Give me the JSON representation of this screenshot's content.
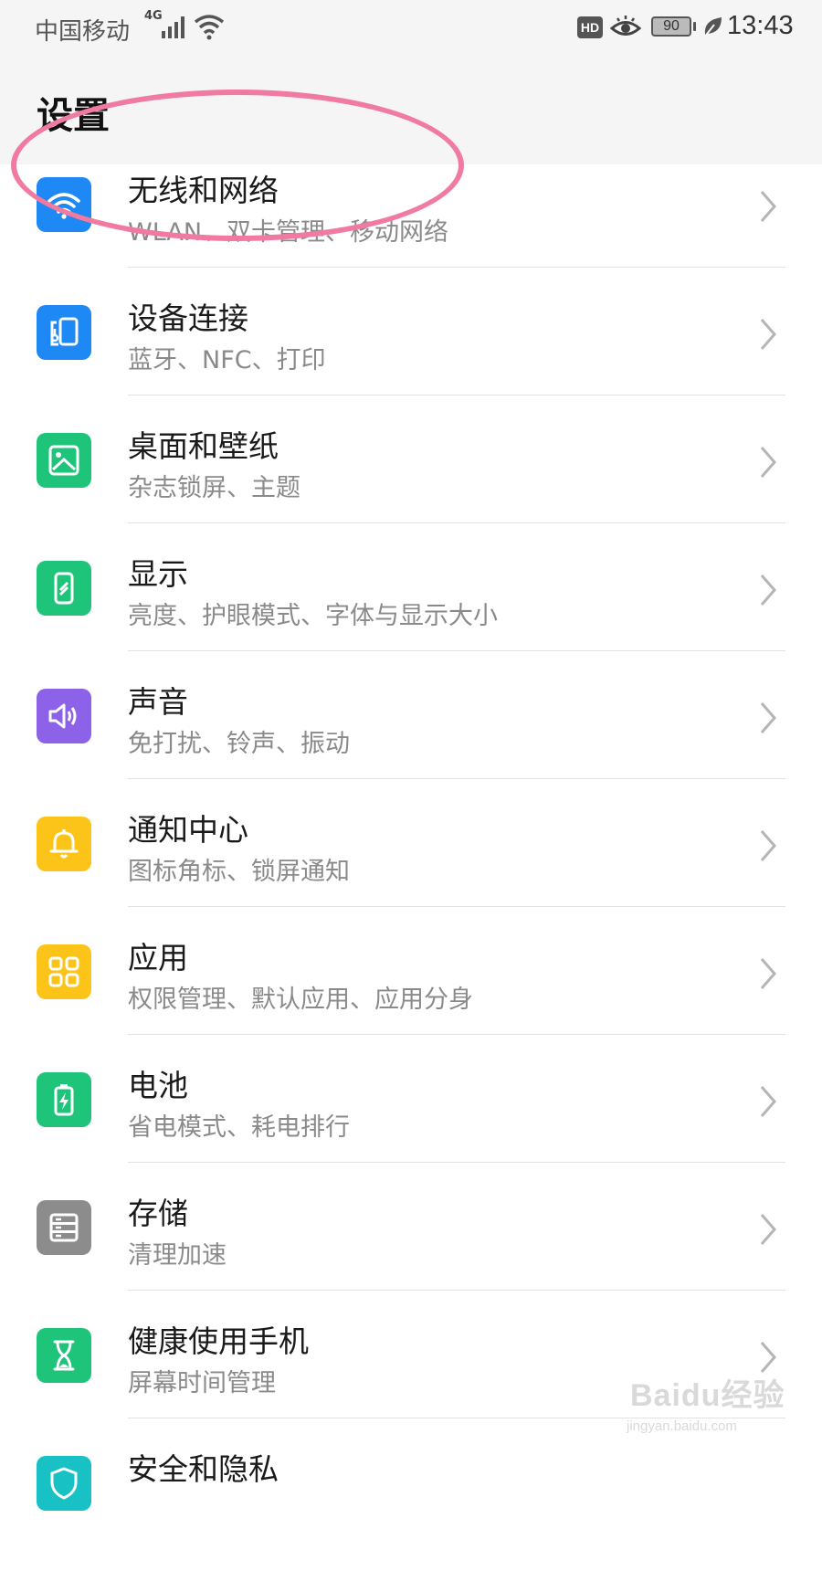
{
  "status_bar": {
    "carrier": "中国移动",
    "network": "4G",
    "hd": "HD",
    "battery": "90",
    "time": "13:43"
  },
  "header": {
    "title": "设置"
  },
  "settings": [
    {
      "title": "无线和网络",
      "subtitle": "WLAN、双卡管理、移动网络",
      "icon": "wifi-icon",
      "color": "#1e88f5"
    },
    {
      "title": "设备连接",
      "subtitle": "蓝牙、NFC、打印",
      "icon": "device-connection-icon",
      "color": "#1e88f5"
    },
    {
      "title": "桌面和壁纸",
      "subtitle": "杂志锁屏、主题",
      "icon": "wallpaper-icon",
      "color": "#1ec47a"
    },
    {
      "title": "显示",
      "subtitle": "亮度、护眼模式、字体与显示大小",
      "icon": "display-icon",
      "color": "#1ec47a"
    },
    {
      "title": "声音",
      "subtitle": "免打扰、铃声、振动",
      "icon": "sound-icon",
      "color": "#8b62e8"
    },
    {
      "title": "通知中心",
      "subtitle": "图标角标、锁屏通知",
      "icon": "bell-icon",
      "color": "#fcc419"
    },
    {
      "title": "应用",
      "subtitle": "权限管理、默认应用、应用分身",
      "icon": "apps-icon",
      "color": "#fcc419"
    },
    {
      "title": "电池",
      "subtitle": "省电模式、耗电排行",
      "icon": "battery-icon",
      "color": "#1ec47a"
    },
    {
      "title": "存储",
      "subtitle": "清理加速",
      "icon": "storage-icon",
      "color": "#8c8c8c"
    },
    {
      "title": "健康使用手机",
      "subtitle": "屏幕时间管理",
      "icon": "hourglass-icon",
      "color": "#1ec47a"
    },
    {
      "title": "安全和隐私",
      "subtitle": "",
      "icon": "security-icon",
      "color": "#17c1c4"
    }
  ],
  "watermark": {
    "logo": "Baidu经验",
    "url": "jingyan.baidu.com"
  }
}
